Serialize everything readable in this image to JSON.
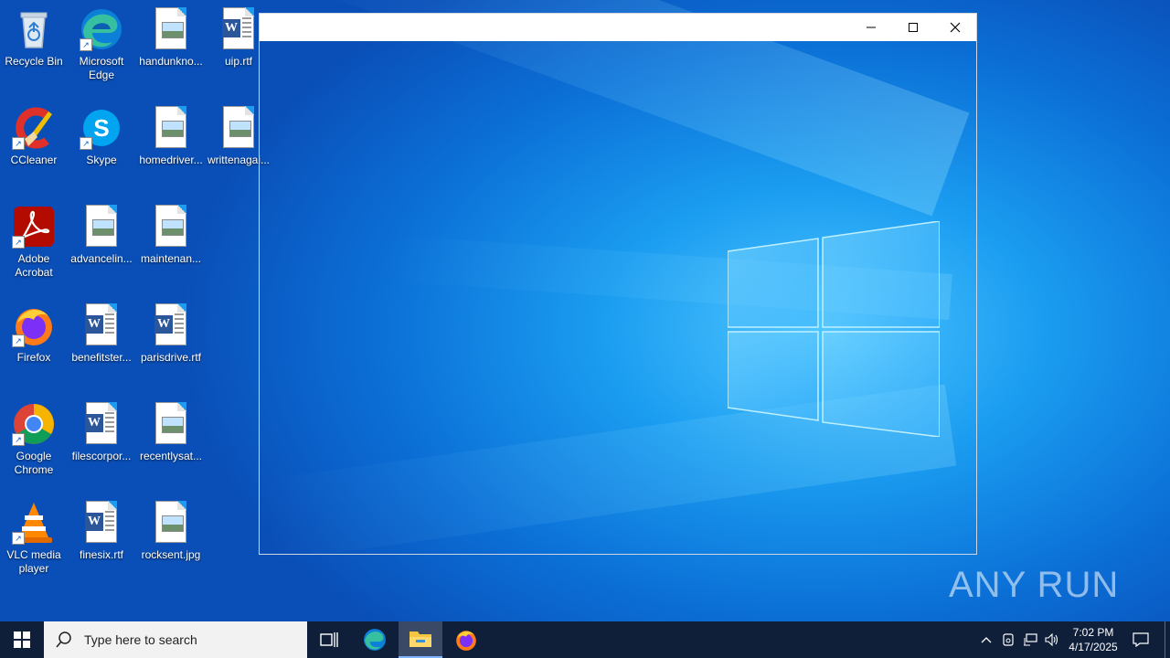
{
  "desktop": {
    "icons": [
      {
        "label": "Recycle Bin",
        "icon": "recycle-bin-icon",
        "shortcut": false
      },
      {
        "label": "Microsoft Edge",
        "icon": "edge-icon",
        "shortcut": true
      },
      {
        "label": "handunkno...",
        "icon": "image-file-icon",
        "shortcut": false
      },
      {
        "label": "uip.rtf",
        "icon": "word-document-icon",
        "shortcut": false
      },
      {
        "label": "CCleaner",
        "icon": "ccleaner-icon",
        "shortcut": true
      },
      {
        "label": "Skype",
        "icon": "skype-icon",
        "shortcut": true
      },
      {
        "label": "homedriver...",
        "icon": "image-file-icon",
        "shortcut": false
      },
      {
        "label": "writtenagai...",
        "icon": "image-file-icon",
        "shortcut": false
      },
      {
        "label": "Adobe Acrobat",
        "icon": "acrobat-icon",
        "shortcut": true
      },
      {
        "label": "advancelin...",
        "icon": "image-file-icon",
        "shortcut": false
      },
      {
        "label": "maintenan...",
        "icon": "image-file-icon",
        "shortcut": false
      },
      {
        "label": "Firefox",
        "icon": "firefox-icon",
        "shortcut": true
      },
      {
        "label": "benefitster...",
        "icon": "word-document-icon",
        "shortcut": false
      },
      {
        "label": "parisdrive.rtf",
        "icon": "word-document-icon",
        "shortcut": false
      },
      {
        "label": "Google Chrome",
        "icon": "chrome-icon",
        "shortcut": true
      },
      {
        "label": "filescorpor...",
        "icon": "word-document-icon",
        "shortcut": false
      },
      {
        "label": "recentlysat...",
        "icon": "image-file-icon",
        "shortcut": false
      },
      {
        "label": "VLC media player",
        "icon": "vlc-icon",
        "shortcut": true
      },
      {
        "label": "finesix.rtf",
        "icon": "word-document-icon",
        "shortcut": false
      },
      {
        "label": "rocksent.jpg",
        "icon": "image-file-icon",
        "shortcut": false
      }
    ],
    "watermark": "ANY RUN"
  },
  "window": {
    "title": "",
    "minimize_icon": "minimize-icon",
    "maximize_icon": "maximize-icon",
    "close_icon": "close-icon"
  },
  "taskbar": {
    "start_icon": "windows-start-icon",
    "search_placeholder": "Type here to search",
    "pinned": [
      {
        "name": "task-view",
        "icon": "task-view-icon",
        "active": false
      },
      {
        "name": "edge",
        "icon": "edge-icon",
        "active": false
      },
      {
        "name": "file-explorer",
        "icon": "folder-icon",
        "active": true
      },
      {
        "name": "firefox",
        "icon": "firefox-icon",
        "active": false
      }
    ],
    "tray": {
      "time": "7:02 PM",
      "date": "4/17/2025"
    }
  },
  "colors": {
    "taskbar_bg": "#0f1f3a",
    "active_item_bg": "#3a4a66",
    "desktop_accent": "#1a9cf0"
  }
}
